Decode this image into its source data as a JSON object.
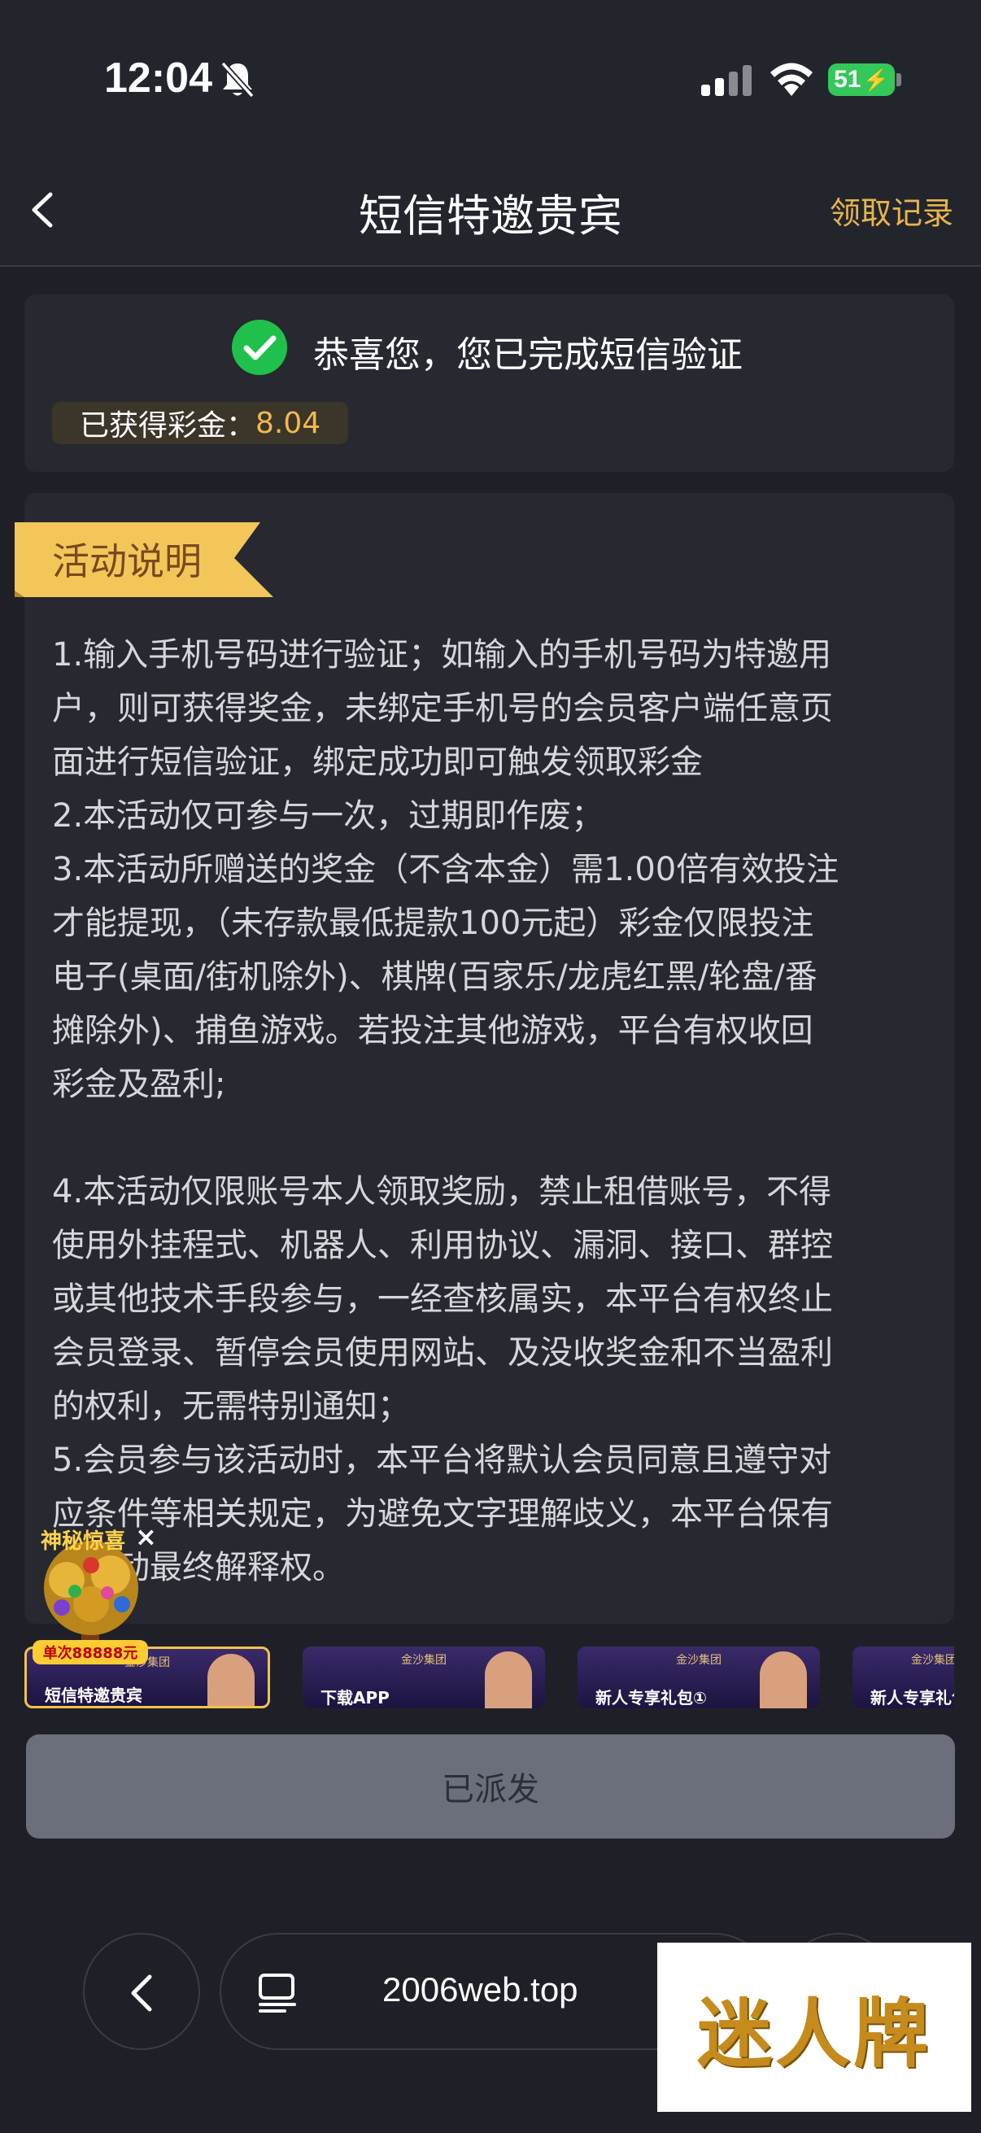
{
  "status_bar": {
    "time": "12:04",
    "battery": "51"
  },
  "header": {
    "title": "短信特邀贵宾",
    "records_label": "领取记录"
  },
  "verify": {
    "message": "恭喜您，您已完成短信验证",
    "bonus_label": "已获得彩金：",
    "bonus_value": "8.04"
  },
  "description": {
    "ribbon_title": "活动说明",
    "body": "1.输入手机号码进行验证；如输入的手机号码为特邀用\n户，则可获得奖金，未绑定手机号的会员客户端任意页\n面进行短信验证，绑定成功即可触发领取彩金\n2.本活动仅可参与一次，过期即作废；\n3.本活动所赠送的奖金（不含本金）需1.00倍有效投注\n才能提现，（未存款最低提款100元起）彩金仅限投注\n电子(桌面/街机除外)、棋牌(百家乐/龙虎红黑/轮盘/番\n摊除外)、捕鱼游戏。若投注其他游戏，平台有权收回\n彩金及盈利;\n\n4.本活动仅限账号本人领取奖励，禁止租借账号，不得\n使用外挂程式、机器人、利用协议、漏洞、接口、群控\n或其他技术手段参与，一经查核属实，本平台有权终止\n会员登录、暂停会员使用网站、及没收奖金和不当盈利\n的权利，无需特别通知；\n5.会员参与该活动时，本平台将默认会员同意且遵守对\n应条件等相关规定，为避免文字理解歧义，本平台保有\n本活动最终解释权。"
  },
  "floating_widget": {
    "title": "神秘惊喜",
    "close": "×",
    "badge": "单次88888元"
  },
  "promos": [
    {
      "label": "短信特邀贵宾",
      "top": "金沙集团"
    },
    {
      "label": "下载APP",
      "top": "金沙集团"
    },
    {
      "label": "新人专享礼包①",
      "top": "金沙集团"
    },
    {
      "label": "新人专享礼包",
      "top": "金沙集团"
    }
  ],
  "action": {
    "dispatched_label": "已派发"
  },
  "browser": {
    "url": "2006web.top"
  },
  "watermark": {
    "text": "迷人牌"
  },
  "colors": {
    "accent_gold": "#e9b44c",
    "success_green": "#1fc04b",
    "background": "#1f2027",
    "card": "#272830"
  }
}
